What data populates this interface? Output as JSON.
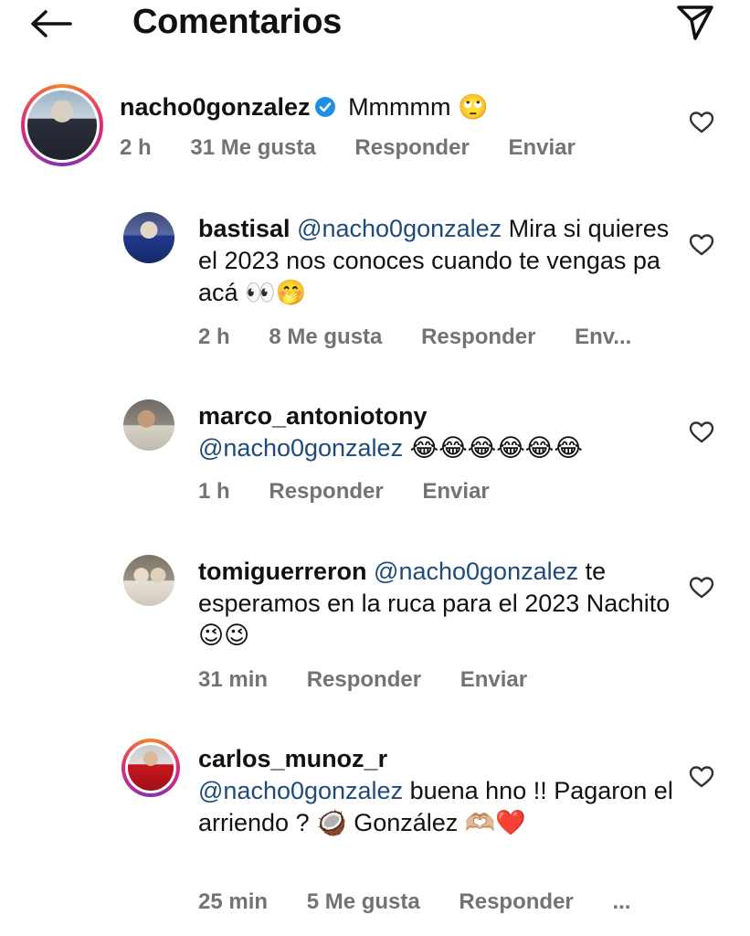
{
  "header": {
    "title": "Comentarios",
    "back_icon": "arrow-left-icon",
    "send_icon": "paper-plane-icon"
  },
  "main_comment": {
    "username": "nacho0gonzalez",
    "text": "Mmmmm 🙄",
    "time": "2 h",
    "likes": "31 Me gusta",
    "reply": "Responder",
    "send": "Enviar"
  },
  "replies": [
    {
      "username": "bastisal",
      "mention": "@nacho0gonzalez",
      "text": " Mira si quieres el 2023 nos conoces cuando te vengas pa acá 👀🤭",
      "time": "2 h",
      "likes": "8 Me gusta",
      "reply": "Responder",
      "send": "Env..."
    },
    {
      "username": "marco_antoniotony",
      "mention": "@nacho0gonzalez",
      "text": " 😂😂😂😂😂😂",
      "time": "1 h",
      "reply": "Responder",
      "send": "Enviar"
    },
    {
      "username": "tomiguerreron",
      "mention": "@nacho0gonzalez",
      "text": " te esperamos en la ruca para el 2023 Nachito😉😉",
      "time": "31 min",
      "reply": "Responder",
      "send": "Enviar"
    },
    {
      "username": "carlos_munoz_r",
      "mention": "@nacho0gonzalez",
      "text": " buena hno !! Pagaron el arriendo ? 🥥 González 🫶🏼❤️",
      "time": "25 min",
      "likes": "5 Me gusta",
      "reply": "Responder",
      "more": "..."
    }
  ],
  "colors": {
    "mention": "#1f4a7c",
    "meta": "#737373",
    "verified": "#1f8fe6"
  }
}
